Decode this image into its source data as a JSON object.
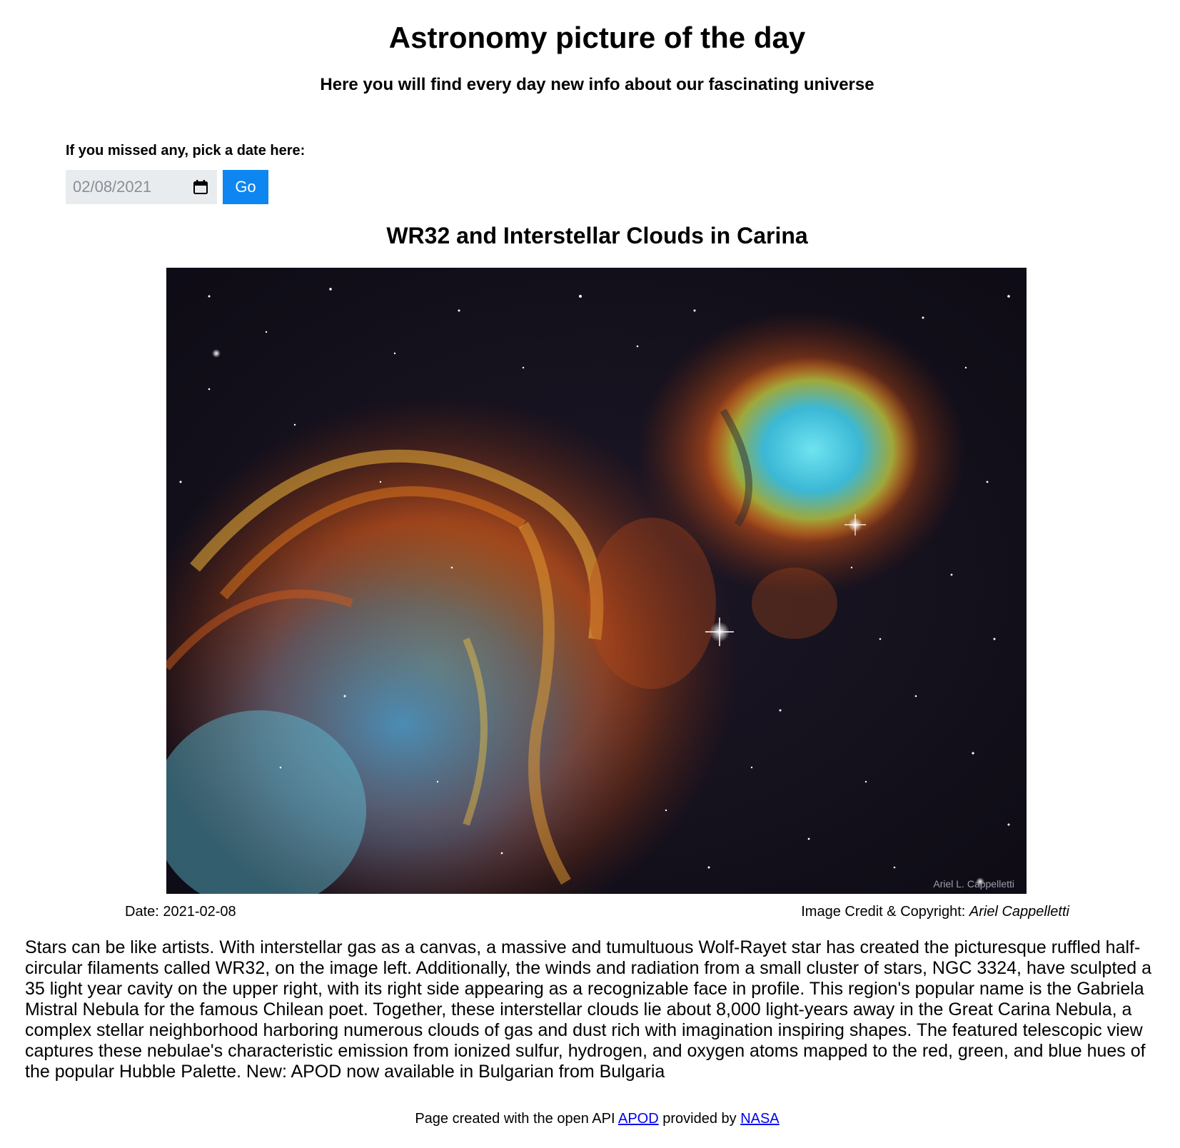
{
  "header": {
    "title": "Astronomy picture of the day",
    "subtitle": "Here you will find every day new info about our fascinating universe"
  },
  "date_picker": {
    "label": "If you missed any, pick a date here:",
    "value": "02/08/2021",
    "calendar_icon": "calendar-icon",
    "go_label": "Go",
    "button_color": "#0d86f2"
  },
  "apod": {
    "title": "WR32 and Interstellar Clouds in Carina",
    "image_watermark": "Ariel L. Cappelletti",
    "date_label": "Date: 2021-02-08",
    "credit_label": "Image Credit & Copyright:",
    "credit_name": "Ariel Cappelletti",
    "explanation": "Stars can be like artists. With interstellar gas as a canvas, a massive and tumultuous Wolf-Rayet star has created the picturesque ruffled half-circular filaments called WR32, on the image left. Additionally, the winds and radiation from a small cluster of stars, NGC 3324, have sculpted a 35 light year cavity on the upper right, with its right side appearing as a recognizable face in profile. This region's popular name is the Gabriela Mistral Nebula for the famous Chilean poet. Together, these interstellar clouds lie about 8,000 light-years away in the Great Carina Nebula, a complex stellar neighborhood harboring numerous clouds of gas and dust rich with imagination inspiring shapes. The featured telescopic view captures these nebulae's characteristic emission from ionized sulfur, hydrogen, and oxygen atoms mapped to the red, green, and blue hues of the popular Hubble Palette. New: APOD now available in Bulgarian from Bulgaria"
  },
  "footer": {
    "text_before": "Page created with the open API ",
    "apod_link": "APOD",
    "text_middle": " provided by ",
    "nasa_link": "NASA"
  }
}
